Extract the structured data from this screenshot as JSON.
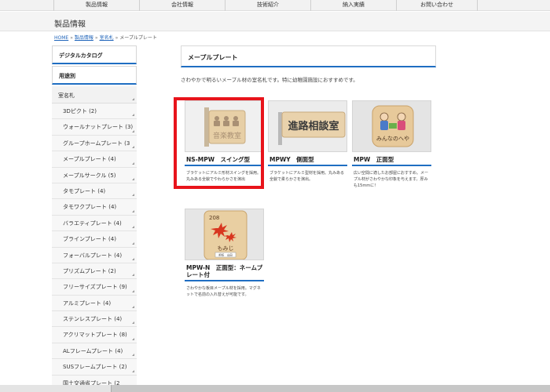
{
  "topnav": {
    "items": [
      "製品情報",
      "会社情報",
      "技術紹介",
      "納入実績",
      "お問い合わせ"
    ]
  },
  "page": {
    "title": "製品情報"
  },
  "breadcrumb": {
    "home": "HOME",
    "sep": "»",
    "products": "製品情報",
    "room": "室名札",
    "current": "メープルプレート"
  },
  "sidebar": {
    "catalog": "デジタルカタログ",
    "usage": "用途別",
    "category": "室名札",
    "items": [
      "3Dピクト (2)",
      "ウォールナットプレート (3)",
      "グループホームプレート (3",
      "メープルプレート (4)",
      "メープルサークル (5)",
      "タモプレート (4)",
      "タモワクプレート (4)",
      "バラエティプレート (4)",
      "ブラインプレート (4)",
      "フォーバルプレート (4)",
      "プリズムプレート (2)",
      "フリーサイズプレート (9)",
      "アルミプレート (4)",
      "ステンレスプレート (4)",
      "アクリマットプレート (8)",
      "ALフレームプレート (4)",
      "SUSフレームプレート (2)",
      "国土交通省プレート (2"
    ]
  },
  "main": {
    "title": "メープルプレート",
    "description": "さわやかで明るいメープル材の室名札です。特に幼稚園施設におすすめです。",
    "products": [
      {
        "name": "NS-MPW　スイング型",
        "desc": "ブラケットにアルミ形材スイングを採用。丸みある全貌でやわらかさを演出",
        "sign_text": "音楽教室"
      },
      {
        "name": "MPWY　側面型",
        "desc": "ブラケットにアルミ型材を採用。丸みある全貌で柔らかさを演出。",
        "sign_text": "進路相談室"
      },
      {
        "name": "MPW　正面型",
        "desc": "広い空間に適したお部屋におすすめ。メープル材がさわやかな印象を与えます。厚みも15mmに！",
        "sign_text": "みんなのへや"
      },
      {
        "name": "MPW-N　正面型：ネームプレート付",
        "desc": "さわやかな板目メープル材を採用。マグネットで名前の入れ替えが可能です。",
        "sign_number": "208",
        "sign_text": "もみじ",
        "sign_small": "担任　山田"
      }
    ]
  },
  "colors": {
    "accent": "#1f6ec2",
    "highlight": "#e8141b"
  }
}
